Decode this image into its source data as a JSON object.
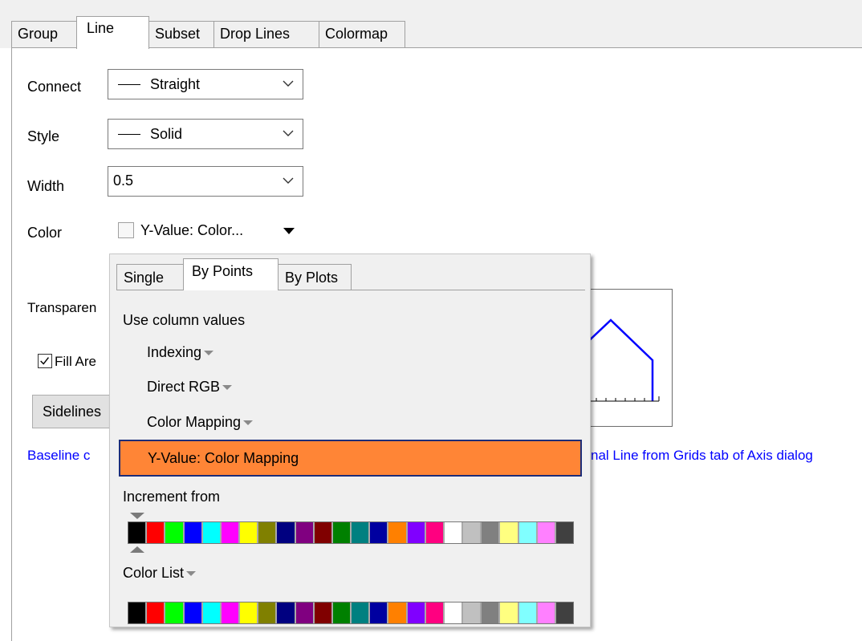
{
  "tabs": [
    {
      "label": "Group"
    },
    {
      "label": "Line"
    },
    {
      "label": "Subset"
    },
    {
      "label": "Drop Lines"
    },
    {
      "label": "Colormap"
    }
  ],
  "form": {
    "connect": {
      "label": "Connect",
      "value": "Straight"
    },
    "style": {
      "label": "Style",
      "value": "Solid"
    },
    "width": {
      "label": "Width",
      "value": "0.5"
    },
    "color": {
      "label": "Color",
      "value": "Y-Value: Color..."
    },
    "transparency_label": "Transparen",
    "fill_area_label": "Fill Are",
    "fill_area_checked": true,
    "sidelines_label": "Sidelines",
    "baseline_link_left": "Baseline c",
    "baseline_link_right": "nal Line from Grids tab of Axis dialog"
  },
  "popup": {
    "tabs": [
      {
        "label": "Single"
      },
      {
        "label": "By Points"
      },
      {
        "label": "By Plots"
      }
    ],
    "active_tab": "By Points",
    "section_title": "Use column values",
    "items": [
      {
        "label": "Indexing"
      },
      {
        "label": "Direct RGB"
      },
      {
        "label": "Color Mapping"
      }
    ],
    "selected_item": "Y-Value: Color Mapping",
    "increment_label": "Increment from",
    "color_list_label": "Color List",
    "palette": [
      "#000000",
      "#ff0000",
      "#00ff00",
      "#0000ff",
      "#00ffff",
      "#ff00ff",
      "#ffff00",
      "#808000",
      "#000080",
      "#800080",
      "#800000",
      "#008000",
      "#008080",
      "#0000a0",
      "#ff8000",
      "#8000ff",
      "#ff0080",
      "#ffffff",
      "#c0c0c0",
      "#808080",
      "#ffff80",
      "#80ffff",
      "#ff80ff",
      "#404040"
    ]
  },
  "colors": {
    "selected_highlight": "#ff8536",
    "link_blue": "#0000ff",
    "preview_line": "#0000ff"
  }
}
